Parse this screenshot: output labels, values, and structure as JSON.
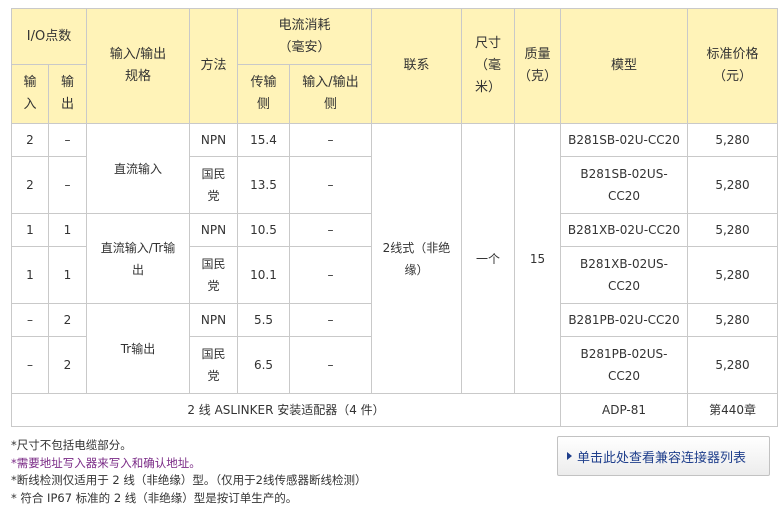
{
  "table": {
    "headers": {
      "io_points": "I/O点数",
      "in": "输\n入",
      "out": "输\n出",
      "spec": "输入/输出\n规格",
      "method": "方法",
      "current": "电流消耗\n（毫安）",
      "current_sensor": "传输\n侧",
      "current_io": "输入/输出\n侧",
      "connection": "联系",
      "size": "尺寸\n（毫\n米）",
      "weight": "质量\n（克）",
      "model": "模型",
      "price": "标准价格\n（元）"
    },
    "rows": [
      {
        "in": "2",
        "out": "–",
        "method": "NPN",
        "sensor_ma": "15.4",
        "io_ma": "–",
        "model": "B281SB-02U-CC20",
        "price": "5,280"
      },
      {
        "in": "2",
        "out": "–",
        "method": "国民\n党",
        "sensor_ma": "13.5",
        "io_ma": "–",
        "model": "B281SB-02US-\nCC20",
        "price": "5,280"
      },
      {
        "in": "1",
        "out": "1",
        "method": "NPN",
        "sensor_ma": "10.5",
        "io_ma": "–",
        "model": "B281XB-02U-CC20",
        "price": "5,280"
      },
      {
        "in": "1",
        "out": "1",
        "method": "国民\n党",
        "sensor_ma": "10.1",
        "io_ma": "–",
        "model": "B281XB-02US-\nCC20",
        "price": "5,280"
      },
      {
        "in": "–",
        "out": "2",
        "method": "NPN",
        "sensor_ma": "5.5",
        "io_ma": "–",
        "model": "B281PB-02U-CC20",
        "price": "5,280"
      },
      {
        "in": "–",
        "out": "2",
        "method": "国民\n党",
        "sensor_ma": "6.5",
        "io_ma": "–",
        "model": "B281PB-02US-\nCC20",
        "price": "5,280"
      }
    ],
    "spec_groups": [
      "直流输入",
      "直流输入/Tr输\n出",
      "Tr输出"
    ],
    "connection": "2线式（非绝\n缘）",
    "size": "一个",
    "weight": "15",
    "accessory": {
      "label": "2 线 ASLINKER 安装适配器（4 件）",
      "model": "ADP-81",
      "price": "第440章"
    }
  },
  "notes": [
    {
      "text": "*尺寸不包括电缆部分。",
      "link": false
    },
    {
      "text": "*需要地址写入器来写入和确认地址。",
      "link": true
    },
    {
      "text": "*断线检测仅适用于 2 线（非绝缘）型。（仅用于2线传感器断线检测）",
      "link": false
    },
    {
      "text": "* 符合 IP67 标准的 2 线（非绝缘）型是按订单生产的。",
      "link": false
    }
  ],
  "compat_button": {
    "label": "单击此处查看兼容连接器列表"
  }
}
